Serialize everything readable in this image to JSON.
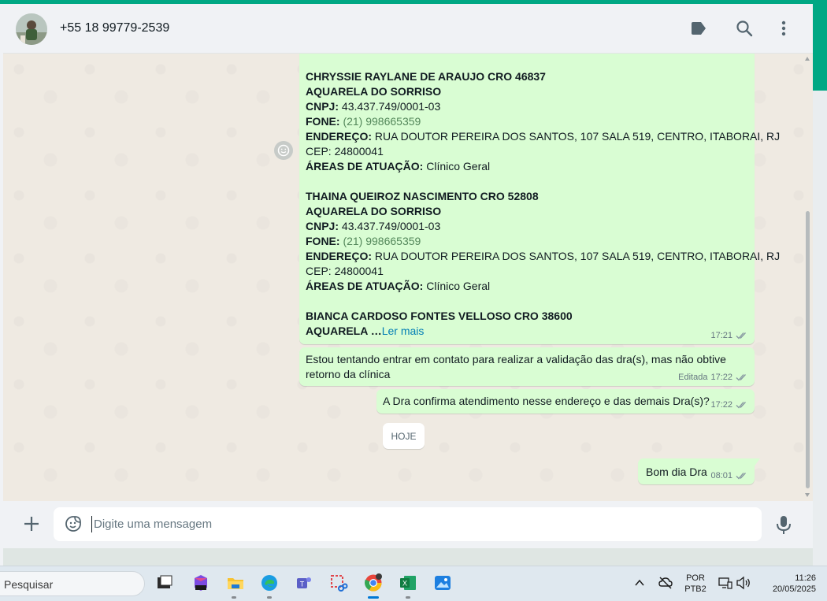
{
  "header": {
    "contact_name": "+55 18 99779-2539",
    "icons": [
      "label-icon",
      "search-icon",
      "menu-icon"
    ]
  },
  "messages": {
    "m1": {
      "d1_name": "CHRYSSIE RAYLANE DE ARAUJO CRO 46837",
      "d1_clinic": "AQUARELA DO SORRISO",
      "cnpj_label": "CNPJ:",
      "d1_cnpj": " 43.437.749/0001-03",
      "fone_label": "FONE:",
      "d1_fone": " (21) 998665359",
      "end_label": "ENDEREÇO:",
      "d1_end": " RUA DOUTOR PEREIRA DOS SANTOS, 107 SALA 519, CENTRO, ITABORAI, RJ",
      "d1_cep": "CEP: 24800041",
      "areas_label": "ÁREAS DE ATUAÇÃO:",
      "d1_areas": " Clínico Geral",
      "d2_name": "THAINA QUEIROZ NASCIMENTO CRO 52808",
      "d2_clinic": "AQUARELA DO SORRISO",
      "d2_cnpj": " 43.437.749/0001-03",
      "d2_fone": " (21) 998665359",
      "d2_end": " RUA DOUTOR PEREIRA DOS SANTOS, 107 SALA 519, CENTRO, ITABORAI, RJ",
      "d2_cep": "CEP: 24800041",
      "d2_areas": " Clínico Geral",
      "d3_name": "BIANCA CARDOSO FONTES VELLOSO CRO 38600",
      "d3_clinic_partial": "AQUARELA …",
      "read_more": "Ler mais",
      "time": "17:21"
    },
    "m2": {
      "line1": "Estou tentando entrar em contato para realizar a validação das dra(s), mas não obtive",
      "line2": "retorno da clínica",
      "edited": "Editada",
      "time": "17:22"
    },
    "m3": {
      "text": "A Dra confirma atendimento nesse endereço e das demais Dra(s)?",
      "time": "17:22"
    },
    "date_divider": "HOJE",
    "m4": {
      "text": "Bom dia Dra",
      "time": "08:01"
    }
  },
  "composer": {
    "placeholder": "Digite uma mensagem"
  },
  "taskbar": {
    "search_placeholder": "Pesquisar",
    "lang1": "POR",
    "lang2": "PTB2",
    "time": "11:26",
    "date": "20/05/2025"
  },
  "colors": {
    "accent": "#00a884",
    "outgoing_bubble": "#d9fdd3",
    "chat_bg": "#efeae2",
    "link": "#027eb5"
  }
}
